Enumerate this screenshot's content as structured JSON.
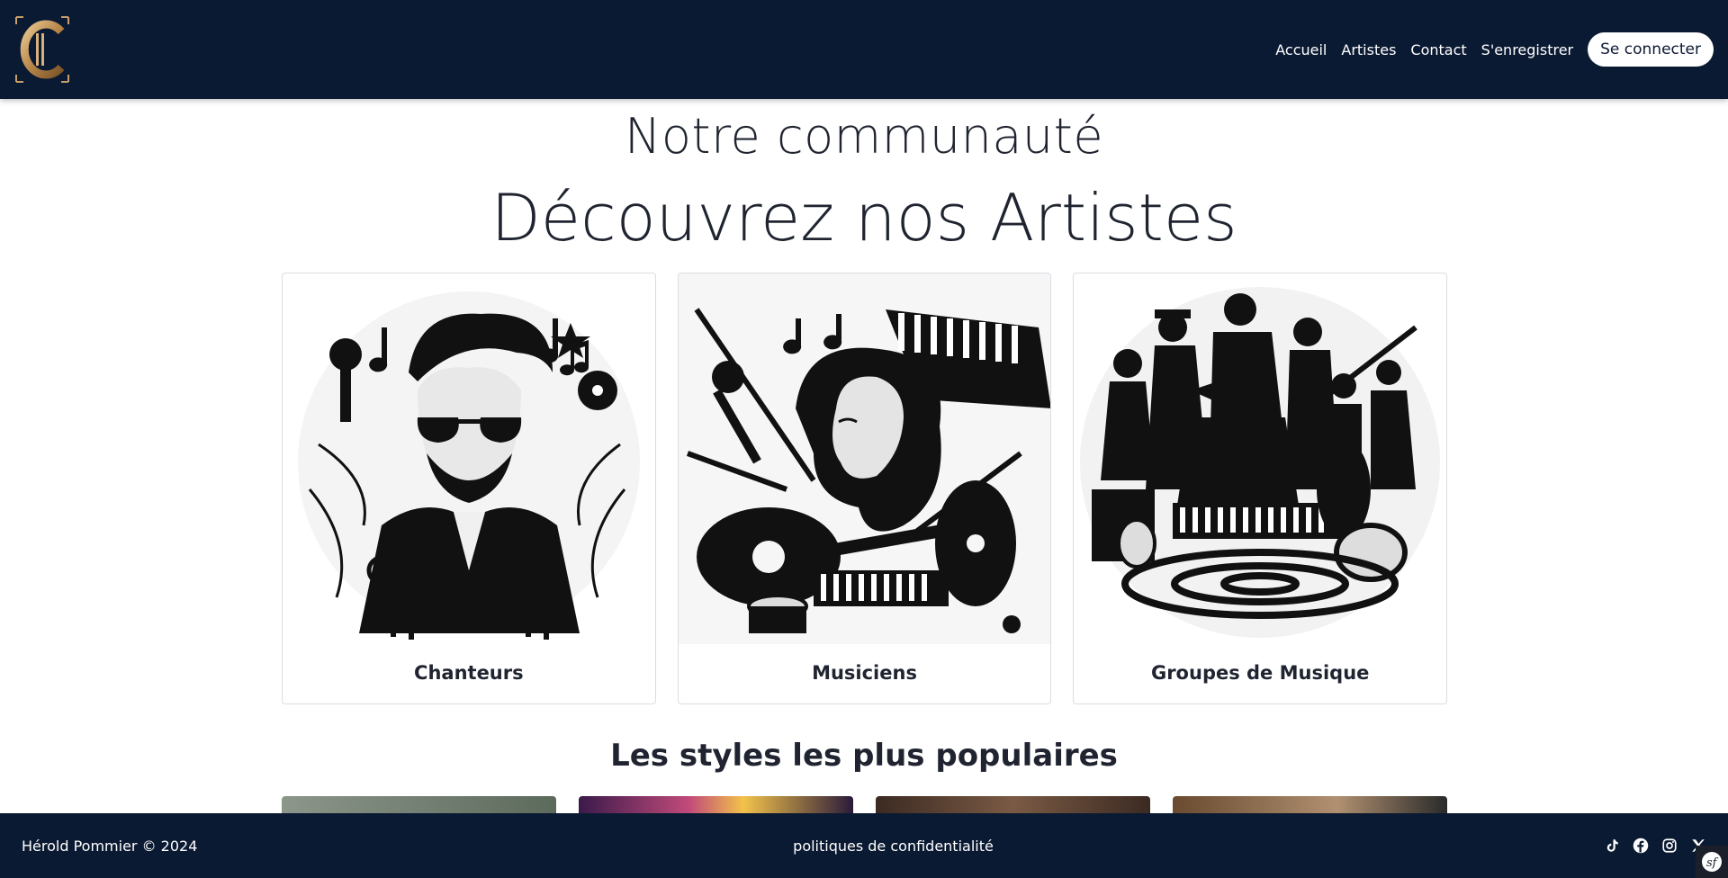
{
  "header": {
    "logo_alt": "C",
    "nav": [
      {
        "label": "Accueil"
      },
      {
        "label": "Artistes"
      },
      {
        "label": "Contact"
      },
      {
        "label": "S'enregistrer"
      }
    ],
    "login_label": "Se connecter"
  },
  "main": {
    "subtitle": "Notre communauté",
    "title": "Découvrez nos Artistes",
    "cards": [
      {
        "label": "Chanteurs",
        "icon": "singer-illustration"
      },
      {
        "label": "Musiciens",
        "icon": "musician-illustration"
      },
      {
        "label": "Groupes de Musique",
        "icon": "band-illustration"
      }
    ],
    "styles_title": "Les styles les plus populaires"
  },
  "footer": {
    "copyright": "Hérold Pommier © 2024",
    "policy": "politiques de confidentialité",
    "socials": [
      "tiktok-icon",
      "facebook-icon",
      "instagram-icon",
      "x-icon"
    ]
  },
  "colors": {
    "navy": "#0b1a33",
    "gold": "#c9a06a",
    "text": "#1f2430"
  }
}
